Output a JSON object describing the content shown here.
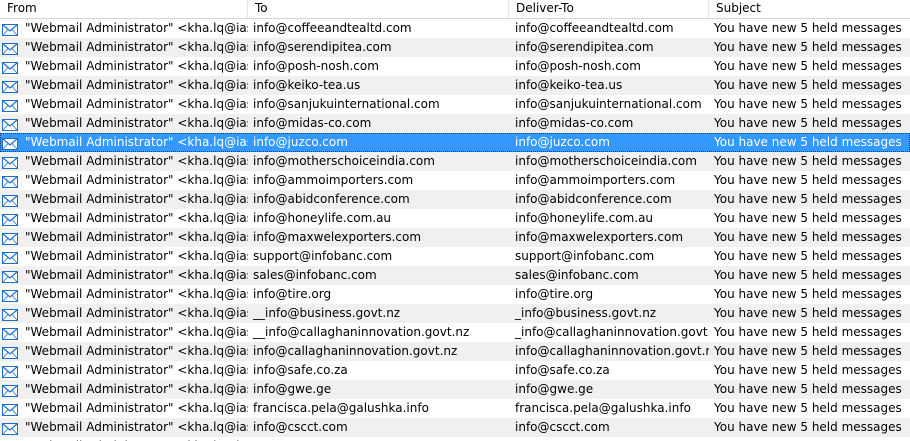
{
  "columns": {
    "from": "From",
    "to": "To",
    "deliver_to": "Deliver-To",
    "subject": "Subject"
  },
  "selected_row": 6,
  "rows": [
    {
      "from": "\"Webmail Administrator\" <kha.lq@iasvn.org>",
      "to": "info@coffeeandtealtd.com",
      "deliver_to": "info@coffeeandtealtd.com",
      "subject": "You have new 5 held messages"
    },
    {
      "from": "\"Webmail Administrator\" <kha.lq@iasvn.org>",
      "to": "info@serendipitea.com",
      "deliver_to": "info@serendipitea.com",
      "subject": "You have new 5 held messages"
    },
    {
      "from": "\"Webmail Administrator\" <kha.lq@iasvn.org>",
      "to": "info@posh-nosh.com",
      "deliver_to": "info@posh-nosh.com",
      "subject": "You have new 5 held messages"
    },
    {
      "from": "\"Webmail Administrator\" <kha.lq@iasvn.org>",
      "to": "info@keiko-tea.us",
      "deliver_to": "info@keiko-tea.us",
      "subject": "You have new 5 held messages"
    },
    {
      "from": "\"Webmail Administrator\" <kha.lq@iasvn.org>",
      "to": "info@sanjukuinternational.com",
      "deliver_to": "info@sanjukuinternational.com",
      "subject": "You have new 5 held messages"
    },
    {
      "from": "\"Webmail Administrator\" <kha.lq@iasvn.org>",
      "to": "info@midas-co.com",
      "deliver_to": "info@midas-co.com",
      "subject": "You have new 5 held messages"
    },
    {
      "from": "\"Webmail Administrator\" <kha.lq@iasvn.org>",
      "to": "info@juzco.com",
      "deliver_to": "info@juzco.com",
      "subject": "You have new 5 held messages"
    },
    {
      "from": "\"Webmail Administrator\" <kha.lq@iasvn.org>",
      "to": "info@motherschoiceindia.com",
      "deliver_to": "info@motherschoiceindia.com",
      "subject": "You have new 5 held messages"
    },
    {
      "from": "\"Webmail Administrator\" <kha.lq@iasvn.org>",
      "to": "info@ammoimporters.com",
      "deliver_to": "info@ammoimporters.com",
      "subject": "You have new 5 held messages"
    },
    {
      "from": "\"Webmail Administrator\" <kha.lq@iasvn.org>",
      "to": "info@abidconference.com",
      "deliver_to": "info@abidconference.com",
      "subject": "You have new 5 held messages"
    },
    {
      "from": "\"Webmail Administrator\" <kha.lq@iasvn.org>",
      "to": "info@honeylife.com.au",
      "deliver_to": "info@honeylife.com.au",
      "subject": "You have new 5 held messages"
    },
    {
      "from": "\"Webmail Administrator\" <kha.lq@iasvn.org>",
      "to": "info@maxwelexporters.com",
      "deliver_to": "info@maxwelexporters.com",
      "subject": "You have new 5 held messages"
    },
    {
      "from": "\"Webmail Administrator\" <kha.lq@iasvn.org>",
      "to": "support@infobanc.com",
      "deliver_to": "support@infobanc.com",
      "subject": "You have new 5 held messages"
    },
    {
      "from": "\"Webmail Administrator\" <kha.lq@iasvn.org>",
      "to": "sales@infobanc.com",
      "deliver_to": "sales@infobanc.com",
      "subject": "You have new 5 held messages"
    },
    {
      "from": "\"Webmail Administrator\" <kha.lq@iasvn.org>",
      "to": "info@tire.org",
      "deliver_to": "info@tire.org",
      "subject": "You have new 5 held messages"
    },
    {
      "from": "\"Webmail Administrator\" <kha.lq@iasvn.org>",
      "to": "__info@business.govt.nz",
      "deliver_to": "_info@business.govt.nz",
      "subject": "You have new 5 held messages"
    },
    {
      "from": "\"Webmail Administrator\" <kha.lq@iasvn.org>",
      "to": "__info@callaghaninnovation.govt.nz",
      "deliver_to": "_info@callaghaninnovation.govt.nz",
      "subject": "You have new 5 held messages"
    },
    {
      "from": "\"Webmail Administrator\" <kha.lq@iasvn.org>",
      "to": "info@callaghaninnovation.govt.nz",
      "deliver_to": "info@callaghaninnovation.govt.nz",
      "subject": "You have new 5 held messages"
    },
    {
      "from": "\"Webmail Administrator\" <kha.lq@iasvn.org>",
      "to": "info@safe.co.za",
      "deliver_to": "info@safe.co.za",
      "subject": "You have new 5 held messages"
    },
    {
      "from": "\"Webmail Administrator\" <kha.lq@iasvn.org>",
      "to": "info@gwe.ge",
      "deliver_to": "info@gwe.ge",
      "subject": "You have new 5 held messages"
    },
    {
      "from": "\"Webmail Administrator\" <kha.lq@iasvn.org>",
      "to": "francisca.pela@galushka.info",
      "deliver_to": "francisca.pela@galushka.info",
      "subject": "You have new 5 held messages"
    },
    {
      "from": "\"Webmail Administrator\" <kha.lq@iasvn.org>",
      "to": "info@cscct.com",
      "deliver_to": "info@cscct.com",
      "subject": "You have new 5 held messages"
    },
    {
      "from": "\"Webmail Administrator\" <kha.lq@iasvn.org>",
      "to": "",
      "deliver_to": "",
      "subject": ""
    }
  ]
}
